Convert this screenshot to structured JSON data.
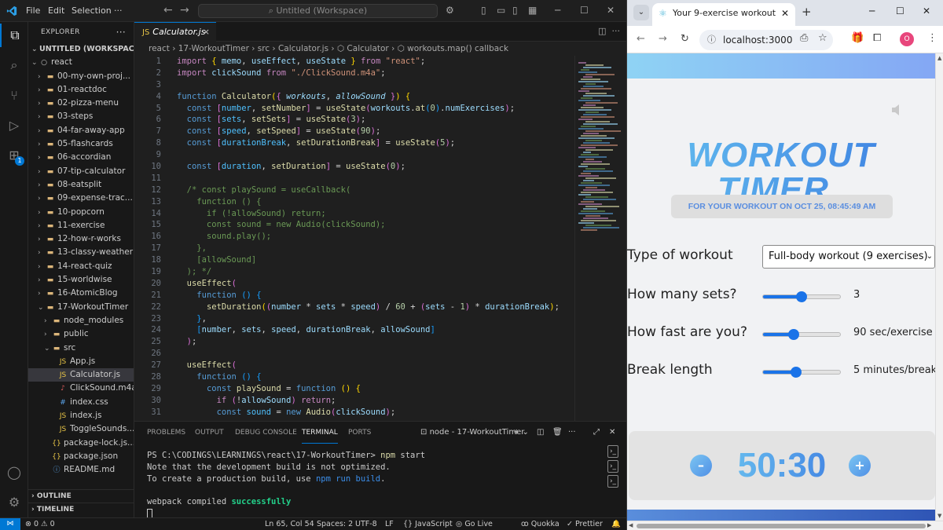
{
  "vscode": {
    "menus": [
      "File",
      "Edit",
      "Selection",
      "···"
    ],
    "command_center": "Untitled (Workspace)",
    "explorer_title": "EXPLORER",
    "workspace": "UNTITLED (WORKSPACE)",
    "activity_badge": "1",
    "tree": [
      {
        "label": "react",
        "type": "root",
        "level": 1
      },
      {
        "label": "00-my-own-proj...",
        "type": "folder",
        "level": 2
      },
      {
        "label": "01-reactdoc",
        "type": "folder",
        "level": 2
      },
      {
        "label": "02-pizza-menu",
        "type": "folder",
        "level": 2
      },
      {
        "label": "03-steps",
        "type": "folder",
        "level": 2
      },
      {
        "label": "04-far-away-app",
        "type": "folder",
        "level": 2
      },
      {
        "label": "05-flashcards",
        "type": "folder",
        "level": 2
      },
      {
        "label": "06-accordian",
        "type": "folder",
        "level": 2
      },
      {
        "label": "07-tip-calculator",
        "type": "folder",
        "level": 2
      },
      {
        "label": "08-eatsplit",
        "type": "folder",
        "level": 2
      },
      {
        "label": "09-expense-trac...",
        "type": "folder",
        "level": 2
      },
      {
        "label": "10-popcorn",
        "type": "folder",
        "level": 2
      },
      {
        "label": "11-exercise",
        "type": "folder",
        "level": 2
      },
      {
        "label": "12-how-r-works",
        "type": "folder",
        "level": 2
      },
      {
        "label": "13-classy-weather",
        "type": "folder",
        "level": 2
      },
      {
        "label": "14-react-quiz",
        "type": "folder",
        "level": 2
      },
      {
        "label": "15-worldwise",
        "type": "folder",
        "level": 2
      },
      {
        "label": "16-AtomicBlog",
        "type": "folder",
        "level": 2
      },
      {
        "label": "17-WorkoutTimer",
        "type": "folder-open",
        "level": 2
      },
      {
        "label": "node_modules",
        "type": "folder",
        "level": 3
      },
      {
        "label": "public",
        "type": "folder",
        "level": 3
      },
      {
        "label": "src",
        "type": "folder-open",
        "level": 3
      },
      {
        "label": "App.js",
        "type": "js",
        "level": 4
      },
      {
        "label": "Calculator.js",
        "type": "js",
        "level": 4,
        "selected": true
      },
      {
        "label": "ClickSound.m4a",
        "type": "audio",
        "level": 4
      },
      {
        "label": "index.css",
        "type": "css",
        "level": 4
      },
      {
        "label": "index.js",
        "type": "js",
        "level": 4
      },
      {
        "label": "ToggleSounds...",
        "type": "js",
        "level": 4
      },
      {
        "label": "package-lock.js...",
        "type": "json",
        "level": 3
      },
      {
        "label": "package.json",
        "type": "json",
        "level": 3
      },
      {
        "label": "README.md",
        "type": "md",
        "level": 3
      }
    ],
    "outline_label": "OUTLINE",
    "timeline_label": "TIMELINE",
    "active_tab": "Calculator.js",
    "breadcrumb": "react  ›  17-WorkoutTimer  ›  src  ›  Calculator.js  ›  ⬡ Calculator  ›  ⬡ workouts.map() callback",
    "code_lines": [
      "<span class=\"kw\">import</span> <span class=\"br1\">{</span> <span class=\"var\">memo</span>, <span class=\"var\">useEffect</span>, <span class=\"var\">useState</span> <span class=\"br1\">}</span> <span class=\"kw\">from</span> <span class=\"str\">\"react\"</span>;",
      "<span class=\"kw\">import</span> <span class=\"var\">clickSound</span> <span class=\"kw\">from</span> <span class=\"str\">\"./ClickSound.m4a\"</span>;",
      "",
      "<span class=\"kw2\">function</span> <span class=\"fn\">Calculator</span><span class=\"br1\">(</span><span class=\"br2\">{</span> <span class=\"par\">workouts</span>, <span class=\"par\">allowSound</span> <span class=\"br2\">}</span><span class=\"br1\">)</span> <span class=\"br1\">{</span>",
      "  <span class=\"kw2\">const</span> <span class=\"br2\">[</span><span class=\"cst\">number</span>, <span class=\"fn\">setNumber</span><span class=\"br2\">]</span> = <span class=\"fn\">useState</span><span class=\"br2\">(</span><span class=\"var\">workouts</span>.<span class=\"fn\">at</span><span class=\"br3\">(</span><span class=\"num\">0</span><span class=\"br3\">)</span>.<span class=\"var\">numExercises</span><span class=\"br2\">)</span>;",
      "  <span class=\"kw2\">const</span> <span class=\"br2\">[</span><span class=\"cst\">sets</span>, <span class=\"fn\">setSets</span><span class=\"br2\">]</span> = <span class=\"fn\">useState</span><span class=\"br2\">(</span><span class=\"num\">3</span><span class=\"br2\">)</span>;",
      "  <span class=\"kw2\">const</span> <span class=\"br2\">[</span><span class=\"cst\">speed</span>, <span class=\"fn\">setSpeed</span><span class=\"br2\">]</span> = <span class=\"fn\">useState</span><span class=\"br2\">(</span><span class=\"num\">90</span><span class=\"br2\">)</span>;",
      "  <span class=\"kw2\">const</span> <span class=\"br2\">[</span><span class=\"cst\">durationBreak</span>, <span class=\"fn\">setDurationBreak</span><span class=\"br2\">]</span> = <span class=\"fn\">useState</span><span class=\"br2\">(</span><span class=\"num\">5</span><span class=\"br2\">)</span>;",
      "",
      "  <span class=\"kw2\">const</span> <span class=\"br2\">[</span><span class=\"cst\">duration</span>, <span class=\"fn\">setDuration</span><span class=\"br2\">]</span> = <span class=\"fn\">useState</span><span class=\"br2\">(</span><span class=\"num\">0</span><span class=\"br2\">)</span>;",
      "",
      "  <span class=\"cmt\">/* const playSound = useCallback(</span>",
      "<span class=\"cmt\">    function () {</span>",
      "<span class=\"cmt\">      if (!allowSound) return;</span>",
      "<span class=\"cmt\">      const sound = new Audio(clickSound);</span>",
      "<span class=\"cmt\">      sound.play();</span>",
      "<span class=\"cmt\">    },</span>",
      "<span class=\"cmt\">    [allowSound]</span>",
      "<span class=\"cmt\">  ); */</span>",
      "  <span class=\"fn\">useEffect</span><span class=\"br2\">(</span>",
      "    <span class=\"kw2\">function</span> <span class=\"br3\">()</span> <span class=\"br3\">{</span>",
      "      <span class=\"fn\">setDuration</span><span class=\"br1\">(</span><span class=\"br2\">(</span><span class=\"var\">number</span> * <span class=\"var\">sets</span> * <span class=\"var\">speed</span><span class=\"br2\">)</span> / <span class=\"num\">60</span> + <span class=\"br2\">(</span><span class=\"var\">sets</span> - <span class=\"num\">1</span><span class=\"br2\">)</span> * <span class=\"var\">durationBreak</span><span class=\"br1\">)</span>;",
      "    <span class=\"br3\">}</span>,",
      "    <span class=\"br3\">[</span><span class=\"var\">number</span>, <span class=\"var\">sets</span>, <span class=\"var\">speed</span>, <span class=\"var\">durationBreak</span>, <span class=\"var\">allowSound</span><span class=\"br3\">]</span>",
      "  <span class=\"br2\">)</span>;",
      "",
      "  <span class=\"fn\">useEffect</span><span class=\"br2\">(</span>",
      "    <span class=\"kw2\">function</span> <span class=\"br3\">()</span> <span class=\"br3\">{</span>",
      "      <span class=\"kw2\">const</span> <span class=\"fn\">playSound</span> = <span class=\"kw2\">function</span> <span class=\"br1\">()</span> <span class=\"br1\">{</span>",
      "        <span class=\"kw\">if</span> <span class=\"br2\">(</span>!<span class=\"var\">allowSound</span><span class=\"br2\">)</span> <span class=\"kw\">return</span>;",
      "        <span class=\"kw2\">const</span> <span class=\"cst\">sound</span> = <span class=\"kw2\">new</span> <span class=\"fn\">Audio</span><span class=\"br2\">(</span><span class=\"var\">clickSound</span><span class=\"br2\">)</span>;"
    ],
    "panel_tabs": [
      "PROBLEMS",
      "OUTPUT",
      "DEBUG CONSOLE",
      "TERMINAL",
      "PORTS"
    ],
    "terminal_name": "node - 17-WorkoutTimer",
    "terminal_lines": [
      "PS C:\\CODINGS\\LEARNINGS\\react\\17-WorkoutTimer> <span class=\"cmd\">npm</span> start",
      "Note that the development build is not optimized.",
      "To create a production build, use <span class=\"link\">npm run build</span>.",
      "",
      "webpack compiled <span class=\"ok\">successfully</span>",
      "<span class=\"cursor\"></span>"
    ],
    "status": {
      "errors": "⊗ 0 ⚠ 0",
      "cursor": "Ln 65, Col 54",
      "spaces": "Spaces: 2",
      "encoding": "UTF-8",
      "eol": "LF",
      "language": "{} JavaScript",
      "golive": "Go Live",
      "quokka": "Quokka",
      "prettier": "✓ Prettier"
    }
  },
  "browser": {
    "tab_title": "Your 9-exercise workout",
    "url": "localhost:3000",
    "profile_letter": "O",
    "app": {
      "title_line1": "WORKOUT",
      "title_line2": "TIMER",
      "date_text": "FOR YOUR WORKOUT ON OCT 25, 08:45:49 AM",
      "type_label": "Type of workout",
      "type_value": "Full-body workout (9 exercises)",
      "sets_label": "How many sets?",
      "sets_value": "3",
      "sets_fraction": 0.5,
      "speed_label": "How fast are you?",
      "speed_value": "90 sec/exercise",
      "speed_fraction": 0.4,
      "break_label": "Break length",
      "break_value": "5 minutes/break",
      "break_fraction": 0.43,
      "timer": "50:30",
      "minus": "–",
      "plus": "+"
    }
  }
}
